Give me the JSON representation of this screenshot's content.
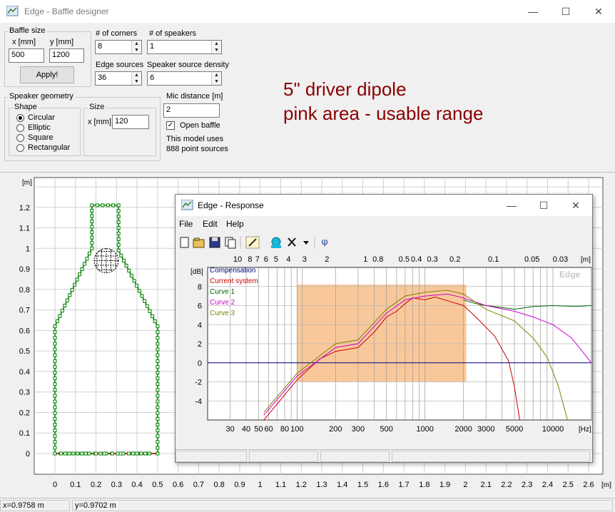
{
  "window": {
    "title": "Edge - Baffle designer",
    "minimize": "—",
    "maximize": "☐",
    "close": "✕"
  },
  "baffle": {
    "group_label": "Baffle size",
    "x_label": "x [mm]",
    "y_label": "y [mm]",
    "x_value": "500",
    "y_value": "1200",
    "apply_label": "Apply!"
  },
  "corners": {
    "label": "# of corners",
    "value": "8"
  },
  "speakers": {
    "label": "# of speakers",
    "value": "1"
  },
  "edge_sources": {
    "label": "Edge sources",
    "value": "36"
  },
  "source_density": {
    "label": "Speaker source density",
    "value": "6"
  },
  "geometry": {
    "group_label": "Speaker geometry",
    "shape_label": "Shape",
    "shapes": [
      "Circular",
      "Elliptic",
      "Square",
      "Rectangular"
    ],
    "selected": "Circular",
    "size_label": "Size",
    "size_x_label": "x [mm]",
    "size_x_value": "120"
  },
  "mic": {
    "label": "Mic distance [m]",
    "value": "2",
    "open_baffle_label": "Open baffle",
    "open_baffle_checked": true,
    "info_line1": "This model uses",
    "info_line2": "888 point sources"
  },
  "note": {
    "line1": "5\" driver dipole",
    "line2": "pink area - usable range"
  },
  "status": {
    "x": "x=0.9758 m",
    "y": "y=0.9702 m"
  },
  "baffle_plot": {
    "y_unit": "[m]",
    "x_unit": "[m]",
    "y_ticks": [
      "0",
      "0.1",
      "0.2",
      "0.3",
      "0.4",
      "0.5",
      "0.6",
      "0.7",
      "0.8",
      "0.9",
      "1",
      "1.1",
      "1.2"
    ],
    "x_ticks": [
      "0",
      "0.1",
      "0.2",
      "0.3",
      "0.4",
      "0.5",
      "0.6",
      "0.7",
      "0.8",
      "0.9",
      "1",
      "1.1",
      "1.2",
      "1.3",
      "1.4",
      "1.5",
      "1.6",
      "1.7",
      "1.8",
      "1.9",
      "2",
      "2.1",
      "2.2",
      "2.3",
      "2.4",
      "2.5",
      "2.6"
    ],
    "outline_color": "#008000",
    "edge_color": "#cc0000"
  },
  "response": {
    "title": "Edge - Response",
    "menu": [
      "File",
      "Edit",
      "Help"
    ],
    "toolbar_icons": [
      "new-icon",
      "open-icon",
      "save-icon",
      "copy-icon",
      "pen-icon",
      "lamp-icon",
      "delete-icon",
      "dropdown-icon",
      "phase-icon"
    ],
    "phase_symbol": "φ",
    "db_unit": "[dB]",
    "hz_unit": "[Hz]",
    "m_unit": "[m]",
    "watermark": "Edge",
    "legend": [
      {
        "name": "Compensation",
        "color": "#000080"
      },
      {
        "name": "Current system",
        "color": "#cc0000"
      },
      {
        "name": "Curve 1",
        "color": "#006400"
      },
      {
        "name": "Curve 2",
        "color": "#cc00cc"
      },
      {
        "name": "Curve 3",
        "color": "#808000"
      }
    ],
    "usable_color": "#f9c89a"
  },
  "chart_data": {
    "type": "line",
    "title": "",
    "xlabel": "[Hz]",
    "ylabel": "[dB]",
    "xscale": "log",
    "xlim": [
      20,
      20000
    ],
    "ylim": [
      -6,
      10
    ],
    "x_ticks": [
      30,
      40,
      50,
      60,
      80,
      100,
      200,
      300,
      500,
      1000,
      2000,
      3000,
      5000,
      10000
    ],
    "y_ticks": [
      -4,
      -2,
      0,
      2,
      4,
      6,
      8
    ],
    "top_axis_m": [
      "10",
      "8",
      "7",
      "6",
      "5",
      "4",
      "3",
      "2",
      "1",
      "0.8",
      "0.5",
      "0.4",
      "0.3",
      "0.2",
      "0.1",
      "0.05",
      "0.03"
    ],
    "usable_range": {
      "x": [
        100,
        2100
      ],
      "y": [
        -2,
        8.2
      ]
    },
    "series": [
      {
        "name": "Compensation",
        "x": [
          20,
          20000
        ],
        "y": [
          0,
          0
        ]
      },
      {
        "name": "Current system",
        "x": [
          55,
          100,
          150,
          200,
          300,
          400,
          500,
          600,
          700,
          800,
          1000,
          1200,
          1500,
          2000,
          2500,
          3500,
          4500,
          5000,
          5500
        ],
        "y": [
          -6,
          -1.8,
          0.4,
          1.2,
          1.6,
          3.2,
          4.8,
          5.4,
          6.2,
          6.8,
          6.6,
          6.9,
          6.5,
          6.0,
          4.8,
          2.8,
          0.2,
          -2.5,
          -6
        ]
      },
      {
        "name": "Curve 1",
        "x": [
          2000,
          2500,
          3000,
          4000,
          5000,
          7000,
          10000,
          15000,
          20000
        ],
        "y": [
          6.6,
          6.2,
          6.0,
          5.8,
          5.6,
          5.9,
          6.0,
          5.9,
          6.0
        ]
      },
      {
        "name": "Curve 2",
        "x": [
          55,
          100,
          200,
          300,
          500,
          700,
          1000,
          1500,
          2000,
          3000,
          5000,
          7000,
          10000,
          14000,
          20000
        ],
        "y": [
          -5.5,
          -1.4,
          1.6,
          2.0,
          5.2,
          6.6,
          7.0,
          7.2,
          6.8,
          6.0,
          5.4,
          4.8,
          4.0,
          2.6,
          0
        ]
      },
      {
        "name": "Curve 3",
        "x": [
          55,
          100,
          200,
          300,
          500,
          700,
          1000,
          1500,
          2000,
          3000,
          5000,
          7000,
          9000,
          11000,
          13000
        ],
        "y": [
          -5.2,
          -1.1,
          2.0,
          2.4,
          5.6,
          7.0,
          7.4,
          7.6,
          7.2,
          5.6,
          4.4,
          2.6,
          0.6,
          -2.4,
          -6
        ]
      }
    ]
  }
}
